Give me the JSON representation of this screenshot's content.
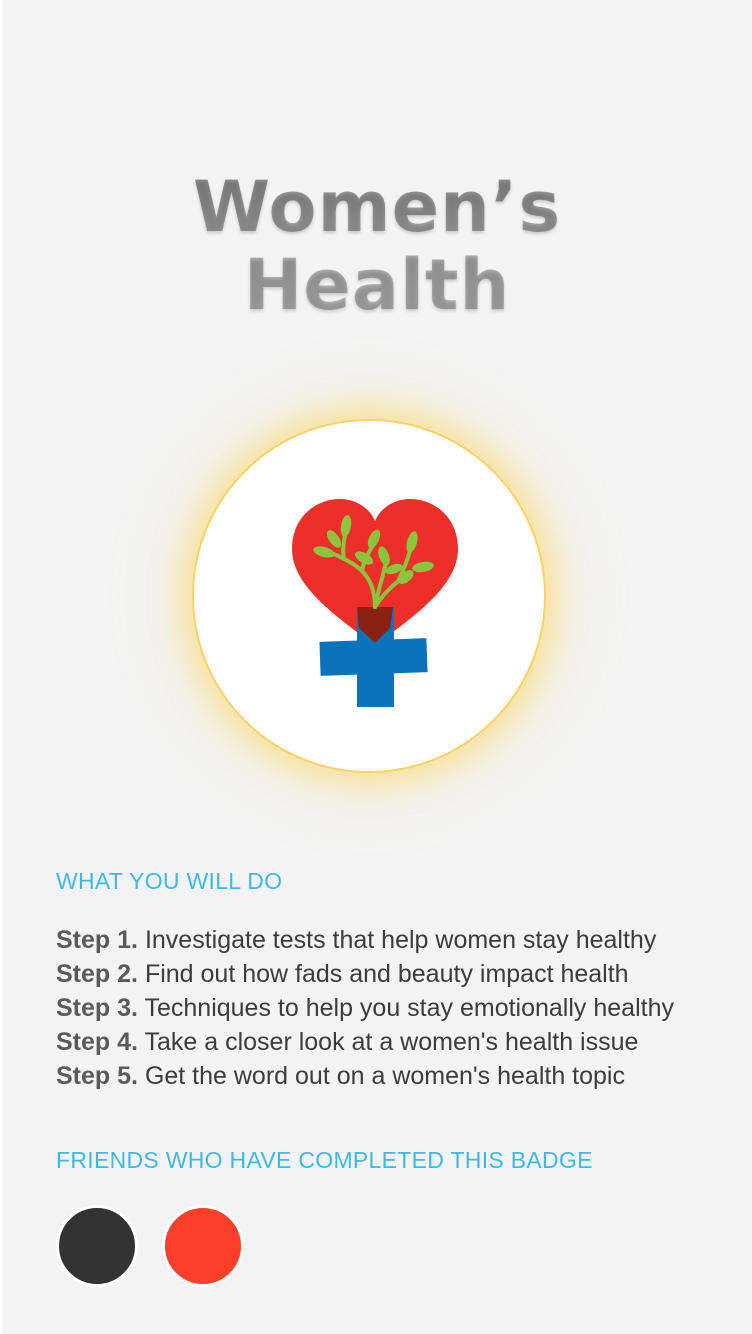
{
  "badge": {
    "title_line1": "Women’s",
    "title_line2": "Health",
    "icon": "heart-with-sprouts-and-cross-icon",
    "colors": {
      "heart": "#ec2f28",
      "sprout": "#8cc43c",
      "pot": "#8a2112",
      "cross": "#0b72bc",
      "ring": "#f6d36a"
    }
  },
  "what_you_will_do": {
    "heading": "WHAT YOU WILL DO",
    "steps": [
      {
        "number": "Step 1.",
        "text": " Investigate tests that help women stay healthy"
      },
      {
        "number": "Step 2.",
        "text": "Find out how fads and beauty impact health"
      },
      {
        "number": "Step 3.",
        "text": "Techniques to help you stay emotionally healthy"
      },
      {
        "number": "Step 4.",
        "text": "Take a closer look at a women's health issue"
      },
      {
        "number": "Step 5.",
        "text": "Get the word out on a women's health topic"
      }
    ]
  },
  "friends": {
    "heading": "FRIENDS WHO HAVE COMPLETED THIS BADGE",
    "avatars": [
      {
        "color": "#333333"
      },
      {
        "color": "#fc3f2a"
      }
    ]
  }
}
